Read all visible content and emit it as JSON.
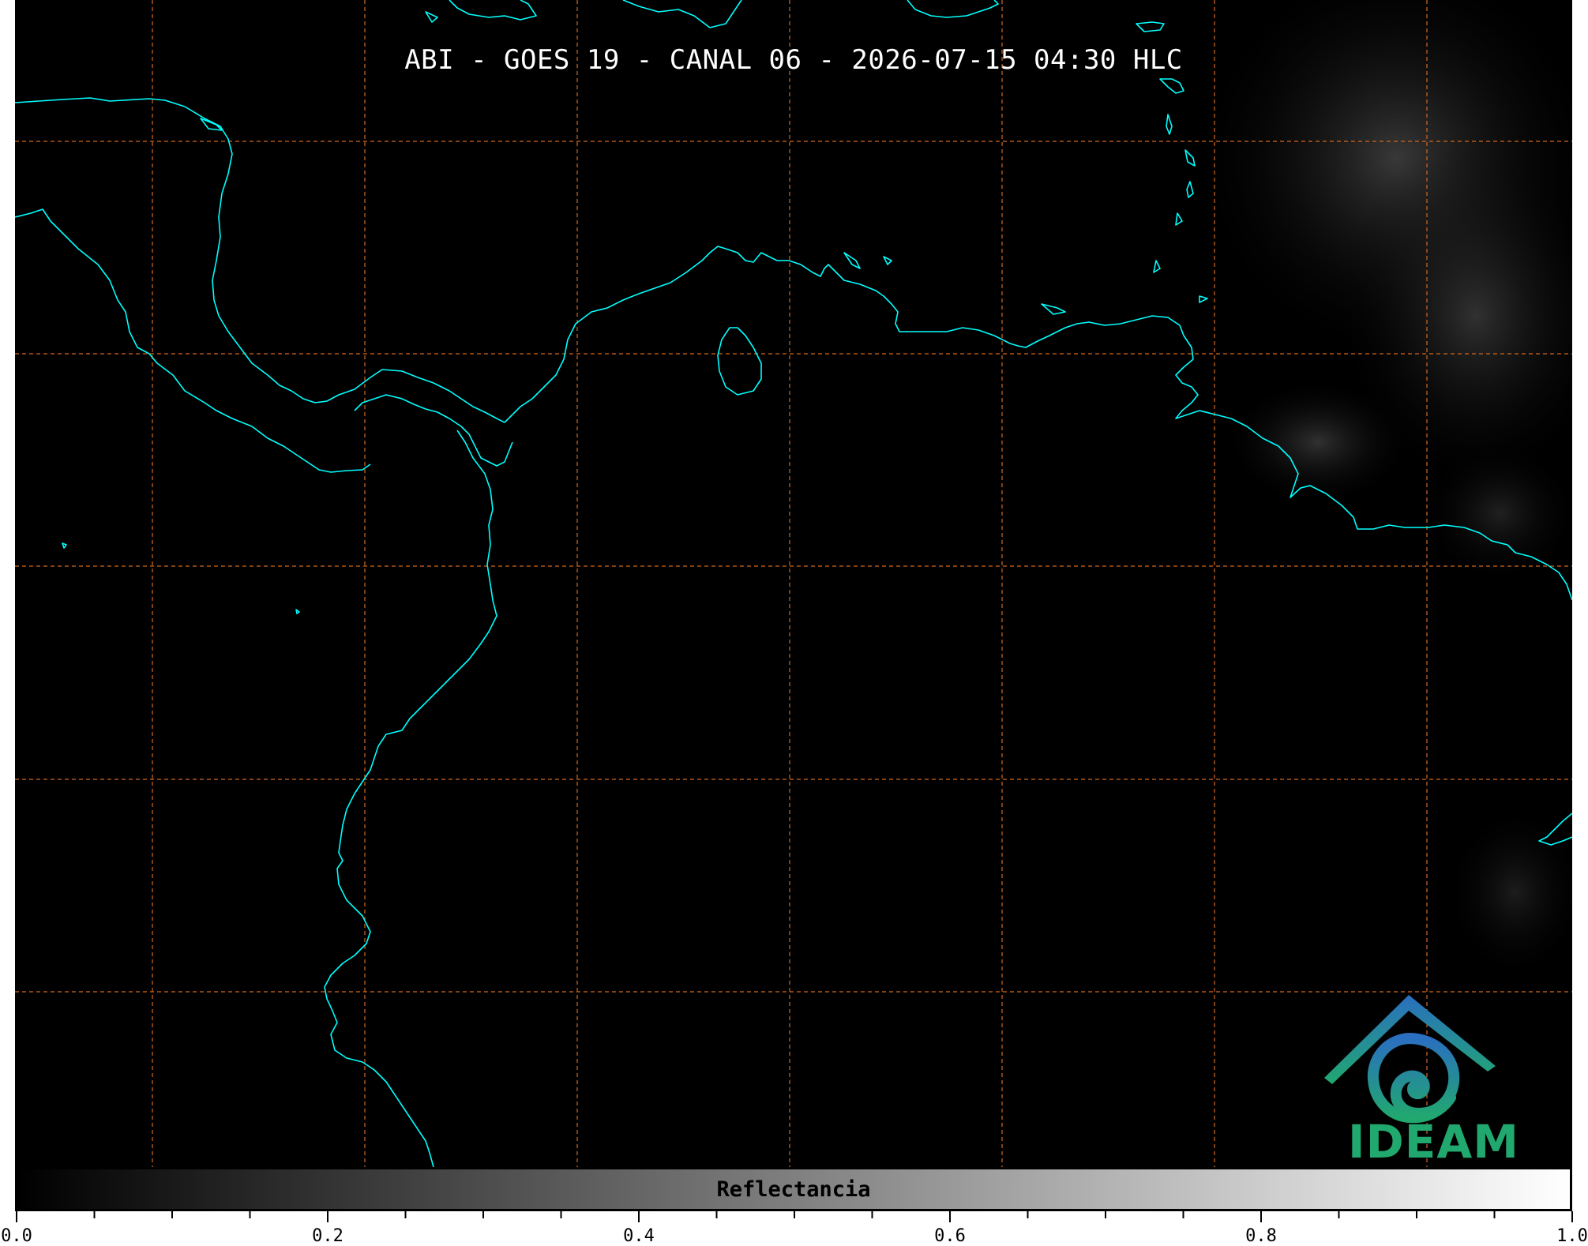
{
  "title": "ABI - GOES 19 - CANAL 06 - 2026-07-15 04:30 HLC",
  "colors": {
    "coastline": "#00ffff",
    "gridline": "#d2691e",
    "background": "#000000",
    "logo_blue": "#2a7fc0",
    "logo_green": "#21a86f"
  },
  "logo": {
    "text": "IDEAM",
    "icon": "ideam-logo-icon"
  },
  "colorbar": {
    "label": "Reflectancia",
    "range": [
      0.0,
      1.0
    ],
    "colormap": "grayscale",
    "major_ticks": [
      "0.0",
      "0.2",
      "0.4",
      "0.6",
      "0.8",
      "1.0"
    ],
    "minor_tick_step": 0.05
  },
  "map": {
    "grid": "dashed",
    "coastlines": true,
    "cloud_cover": "faint clouds in eastern portion"
  }
}
